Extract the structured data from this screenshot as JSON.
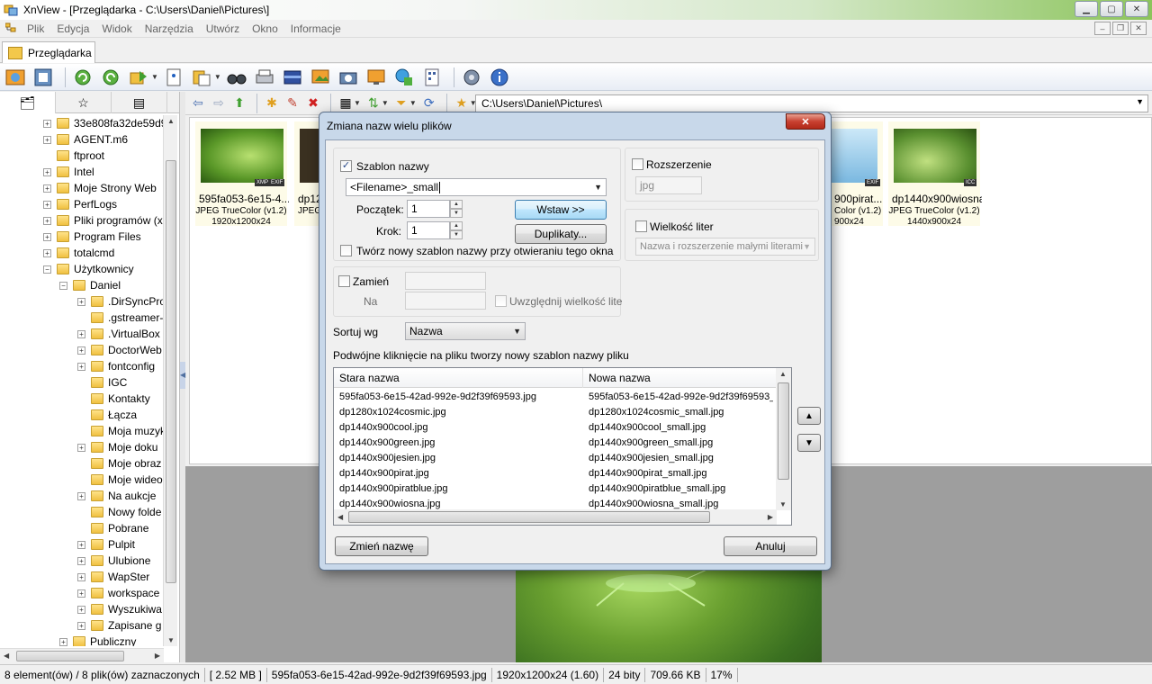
{
  "window": {
    "title": "XnView - [Przeglądarka - C:\\Users\\Daniel\\Pictures\\]",
    "min_label": "▁",
    "max_label": "▢",
    "close_label": "✕"
  },
  "menu": {
    "items": [
      "Plik",
      "Edycja",
      "Widok",
      "Narzędzia",
      "Utwórz",
      "Okno",
      "Informacje"
    ]
  },
  "tab": {
    "label": "Przeglądarka"
  },
  "path": {
    "value": "C:\\Users\\Daniel\\Pictures\\"
  },
  "tree": {
    "items": [
      {
        "label": "33e808fa32de59d9",
        "level": 1,
        "expander": "+"
      },
      {
        "label": "AGENT.m6",
        "level": 1,
        "expander": "+"
      },
      {
        "label": "ftproot",
        "level": 1,
        "expander": ""
      },
      {
        "label": "Intel",
        "level": 1,
        "expander": "+"
      },
      {
        "label": "Moje Strony Web",
        "level": 1,
        "expander": "+"
      },
      {
        "label": "PerfLogs",
        "level": 1,
        "expander": "+"
      },
      {
        "label": "Pliki programów (x",
        "level": 1,
        "expander": "+"
      },
      {
        "label": "Program Files",
        "level": 1,
        "expander": "+"
      },
      {
        "label": "totalcmd",
        "level": 1,
        "expander": "+"
      },
      {
        "label": "Użytkownicy",
        "level": 1,
        "expander": "−"
      },
      {
        "label": "Daniel",
        "level": 2,
        "expander": "−"
      },
      {
        "label": ".DirSyncPro",
        "level": 3,
        "expander": "+"
      },
      {
        "label": ".gstreamer-",
        "level": 3,
        "expander": ""
      },
      {
        "label": ".VirtualBox",
        "level": 3,
        "expander": "+"
      },
      {
        "label": "DoctorWeb",
        "level": 3,
        "expander": "+"
      },
      {
        "label": "fontconfig",
        "level": 3,
        "expander": "+"
      },
      {
        "label": "IGC",
        "level": 3,
        "expander": ""
      },
      {
        "label": "Kontakty",
        "level": 3,
        "expander": ""
      },
      {
        "label": "Łącza",
        "level": 3,
        "expander": ""
      },
      {
        "label": "Moja muzyk",
        "level": 3,
        "expander": ""
      },
      {
        "label": "Moje doku",
        "level": 3,
        "expander": "+"
      },
      {
        "label": "Moje obraz",
        "level": 3,
        "expander": ""
      },
      {
        "label": "Moje wideo",
        "level": 3,
        "expander": ""
      },
      {
        "label": "Na aukcje",
        "level": 3,
        "expander": "+"
      },
      {
        "label": "Nowy folde",
        "level": 3,
        "expander": ""
      },
      {
        "label": "Pobrane",
        "level": 3,
        "expander": ""
      },
      {
        "label": "Pulpit",
        "level": 3,
        "expander": "+"
      },
      {
        "label": "Ulubione",
        "level": 3,
        "expander": "+"
      },
      {
        "label": "WapSter",
        "level": 3,
        "expander": "+"
      },
      {
        "label": "workspace",
        "level": 3,
        "expander": "+"
      },
      {
        "label": "Wyszukiwa",
        "level": 3,
        "expander": "+"
      },
      {
        "label": "Zapisane g",
        "level": 3,
        "expander": "+"
      },
      {
        "label": "Publiczny",
        "level": 2,
        "expander": "+"
      }
    ]
  },
  "thumbnails": [
    {
      "name": "595fa053-6e15-4...",
      "info": "JPEG TrueColor (v1.2)",
      "dim": "1920x1200x24",
      "badges": "XMP EXIF"
    },
    {
      "name": "dp12",
      "info": "JPEG",
      "dim": "1",
      "badges": ""
    },
    {
      "name": "900pirat...",
      "info": "Color (v1.2)",
      "dim": "900x24",
      "badges": "EXIF"
    },
    {
      "name": "dp1440x900wiosna",
      "info": "JPEG TrueColor (v1.2)",
      "dim": "1440x900x24",
      "badges": "ICC"
    }
  ],
  "dialog": {
    "title": "Zmiana nazw wielu plików",
    "close": "✕",
    "template": {
      "label": "Szablon nazwy",
      "checked": true,
      "value": "<Filename>_small",
      "start_label": "Początek:",
      "start_value": "1",
      "step_label": "Krok:",
      "step_value": "1",
      "insert_button": "Wstaw >>",
      "duplicates_button": "Duplikaty...",
      "new_template_label": "Twórz nowy szablon nazwy przy otwieraniu tego okna"
    },
    "extension": {
      "label": "Rozszerzenie",
      "value": "jpg"
    },
    "case": {
      "label": "Wielkość liter",
      "value": "Nazwa i rozszerzenie małymi literami"
    },
    "replace": {
      "label": "Zamień",
      "with_label": "Na",
      "match_case_label": "Uwzględnij wielkość lite"
    },
    "sort": {
      "label": "Sortuj wg",
      "value": "Nazwa"
    },
    "hint": "Podwójne kliknięcie na pliku tworzy nowy szablon nazwy pliku",
    "columns": [
      "Stara nazwa",
      "Nowa nazwa"
    ],
    "rows": [
      {
        "old": "595fa053-6e15-42ad-992e-9d2f39f69593.jpg",
        "new": "595fa053-6e15-42ad-992e-9d2f39f69593_s"
      },
      {
        "old": "dp1280x1024cosmic.jpg",
        "new": "dp1280x1024cosmic_small.jpg"
      },
      {
        "old": "dp1440x900cool.jpg",
        "new": "dp1440x900cool_small.jpg"
      },
      {
        "old": "dp1440x900green.jpg",
        "new": "dp1440x900green_small.jpg"
      },
      {
        "old": "dp1440x900jesien.jpg",
        "new": "dp1440x900jesien_small.jpg"
      },
      {
        "old": "dp1440x900pirat.jpg",
        "new": "dp1440x900pirat_small.jpg"
      },
      {
        "old": "dp1440x900piratblue.jpg",
        "new": "dp1440x900piratblue_small.jpg"
      },
      {
        "old": "dp1440x900wiosna.jpg",
        "new": "dp1440x900wiosna_small.jpg"
      }
    ],
    "rename_button": "Zmień nazwę",
    "cancel_button": "Anuluj"
  },
  "status": {
    "selection": "8 element(ów) / 8 plik(ów) zaznaczonych",
    "size": "[ 2.52 MB ]",
    "file": "595fa053-6e15-42ad-992e-9d2f39f69593.jpg",
    "dimensions": "1920x1200x24 (1.60)",
    "bits": "24 bity",
    "filesize": "709.66 KB",
    "zoom": "17%"
  },
  "colors": {
    "accent": "#8cc45c",
    "dialog_frame": "#c8d8ea",
    "selection": "#fdfbe8"
  }
}
